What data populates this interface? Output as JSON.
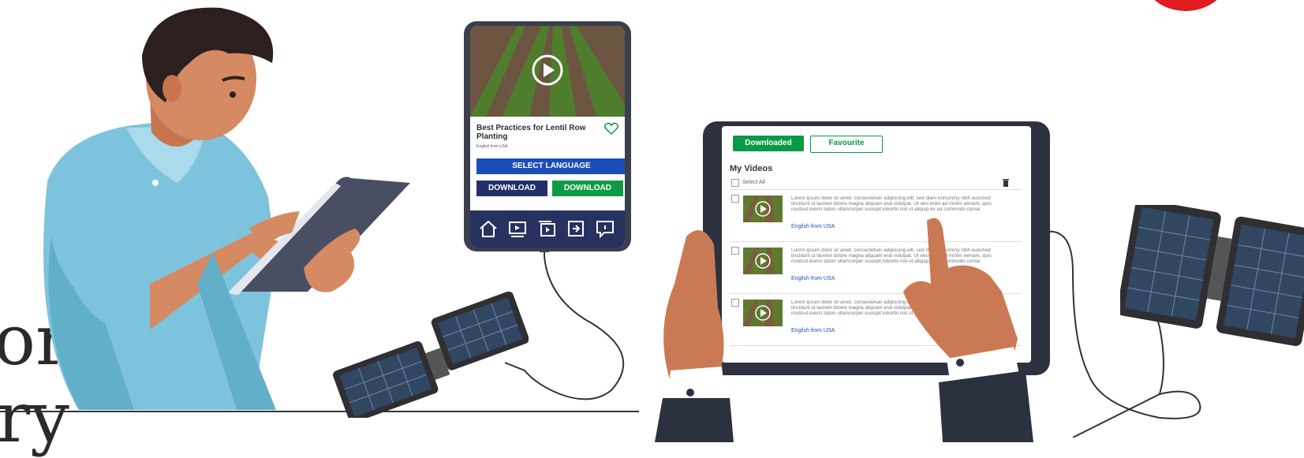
{
  "background_text": {
    "line1": "or",
    "line2": "ry"
  },
  "phone": {
    "video_title": "Best Practices for Lentil Row Planting",
    "video_subtitle": "English from USA",
    "select_language": "SELECT LANGUAGE",
    "download_left": "DOWNLOAD",
    "download_right": "DOWNLOAD",
    "nav_icons": [
      "home-icon",
      "video-list-icon",
      "playlist-icon",
      "share-icon",
      "info-chat-icon"
    ]
  },
  "tablet": {
    "tabs": {
      "downloaded": "Downloaded",
      "favourite": "Favourite"
    },
    "section_title": "My Videos",
    "select_all": "Select All",
    "videos": [
      {
        "description": "Lorem ipsum dolor sit amet, consectetuer adipiscing elit, sed diam nonummy nibh euismod tincidunt ut laoreet dolore magna aliquam erat volutpat. Ut wisi enim ad minim veniam, quis nostrud exerci tation ullamcorper suscipit lobortis nisl ut aliquip ex ea commodo conse",
        "language": "English from USA"
      },
      {
        "description": "Lorem ipsum dolor sit amet, consectetuer adipiscing elit, sed diam nonummy nibh euismod tincidunt ut laoreet dolore magna aliquam erat volutpat. Ut wisi enim ad minim veniam, quis nostrud exerci tation ullamcorper suscipit lobortis nisl ut aliquip ex ea commodo conse",
        "language": "English from USA"
      },
      {
        "description": "Lorem ipsum dolor sit amet, consectetuer adipiscing elit, sed diam nonummy nibh euismod tincidunt ut laoreet dolore magna aliquam erat volutpat. Ut wisi enim ad minim veniam, quis nostrud exerci tation ullamcorper suscipit lobortis nisl ut aliquip ex ea commodo conse",
        "language": "English from USA"
      }
    ]
  },
  "colors": {
    "brand_green": "#0a9a45",
    "brand_blue": "#1b4fb8",
    "navy": "#233068",
    "accent_red": "#e01b22"
  }
}
